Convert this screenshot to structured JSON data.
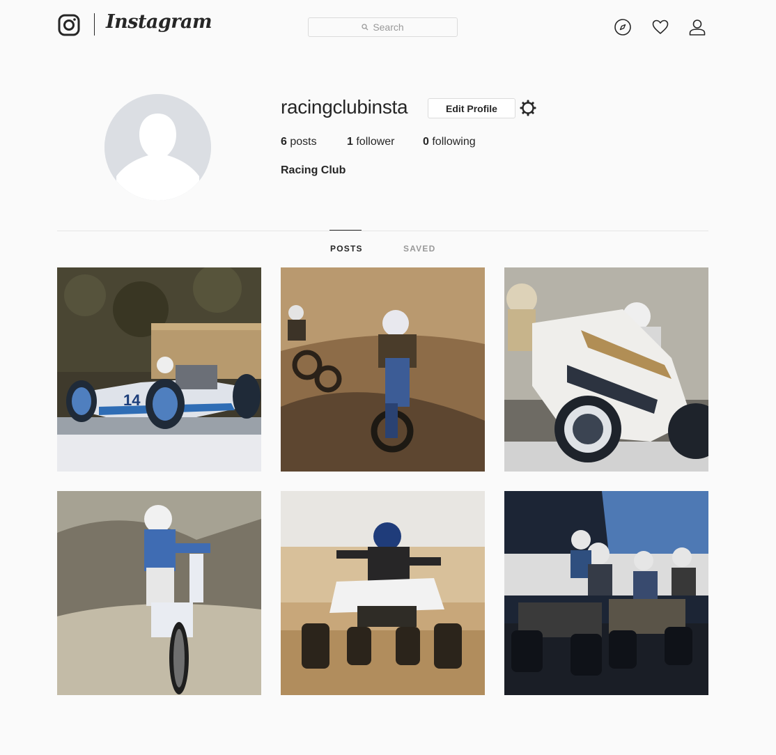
{
  "app": {
    "wordmark": "Instagram",
    "logo_icon": "instagram-camera-icon"
  },
  "header": {
    "search": {
      "placeholder": "Search",
      "icon": "search-icon"
    },
    "nav_icons": [
      "compass-icon",
      "heart-icon",
      "user-icon"
    ]
  },
  "profile": {
    "username": "racingclubinsta",
    "edit_button_label": "Edit Profile",
    "settings_icon": "gear-icon",
    "stats": {
      "posts_count": "6",
      "posts_label": "posts",
      "followers_count": "1",
      "followers_label": "follower",
      "following_count": "0",
      "following_label": "following"
    },
    "full_name": "Racing Club",
    "avatar_icon": "default-avatar-icon"
  },
  "tabs": [
    {
      "label": "POSTS",
      "active": true
    },
    {
      "label": "SAVED",
      "active": false
    }
  ],
  "posts": [
    {
      "subject": "vintage-race-car",
      "number_on_car": "14"
    },
    {
      "subject": "motocross-riders"
    },
    {
      "subject": "superbike-cornering"
    },
    {
      "subject": "motocross-wheelie"
    },
    {
      "subject": "quad-bike-jump"
    },
    {
      "subject": "quad-bike-race-start"
    }
  ],
  "colors": {
    "text": "#262626",
    "muted": "#999999",
    "border": "#dbdbdb",
    "background": "#fafafa"
  }
}
